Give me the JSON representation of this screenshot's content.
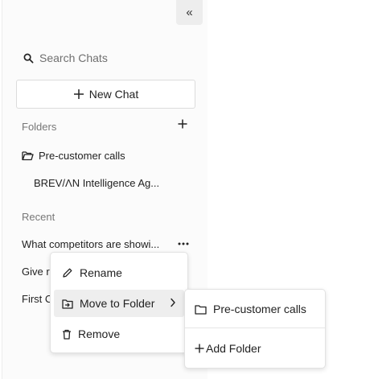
{
  "sidebar": {
    "collapse_glyph": "«",
    "search_placeholder": "Search Chats",
    "new_chat_label": "New Chat",
    "folders_label": "Folders",
    "folder": {
      "name": "Pre-customer calls",
      "chats": [
        "BREV/ΛN Intelligence Ag..."
      ]
    },
    "recent_label": "Recent",
    "recent_chats": [
      "What competitors are showi...",
      "Give r",
      "First C"
    ]
  },
  "context_menu": {
    "rename_label": "Rename",
    "move_label": "Move to Folder",
    "remove_label": "Remove"
  },
  "submenu": {
    "folder_option": "Pre-customer calls",
    "add_folder_label": "Add Folder"
  }
}
